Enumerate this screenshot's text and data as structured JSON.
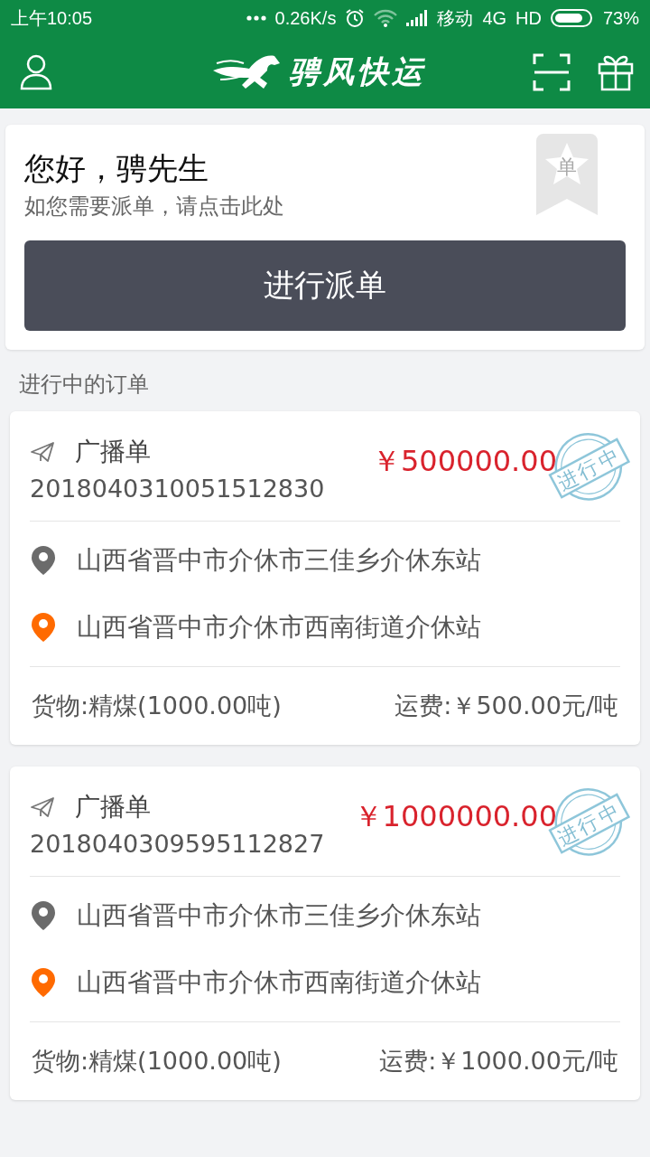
{
  "status_bar": {
    "time": "上午10:05",
    "net_speed": "0.26K/s",
    "carrier": "移动",
    "network": "4G",
    "hd": "HD",
    "battery": "73%"
  },
  "header": {
    "logo_text": "骋风快运"
  },
  "welcome": {
    "greeting": "您好，骋先生",
    "hint": "如您需要派单，请点击此处",
    "badge": "单",
    "button": "进行派单"
  },
  "section_title": "进行中的订单",
  "orders": [
    {
      "type": "广播单",
      "number": "2018040310051512830",
      "price": "￥500000.00",
      "stamp": "进行中",
      "from": "山西省晋中市介休市三佳乡介休东站",
      "to": "山西省晋中市介休市西南街道介休站",
      "cargo": "货物:精煤(1000.00吨)",
      "fee": "运费:￥500.00元/吨"
    },
    {
      "type": "广播单",
      "number": "2018040309595112827",
      "price": "￥1000000.00",
      "stamp": "进行中",
      "from": "山西省晋中市介休市三佳乡介休东站",
      "to": "山西省晋中市介休市西南街道介休站",
      "cargo": "货物:精煤(1000.00吨)",
      "fee": "运费:￥1000.00元/吨"
    }
  ]
}
